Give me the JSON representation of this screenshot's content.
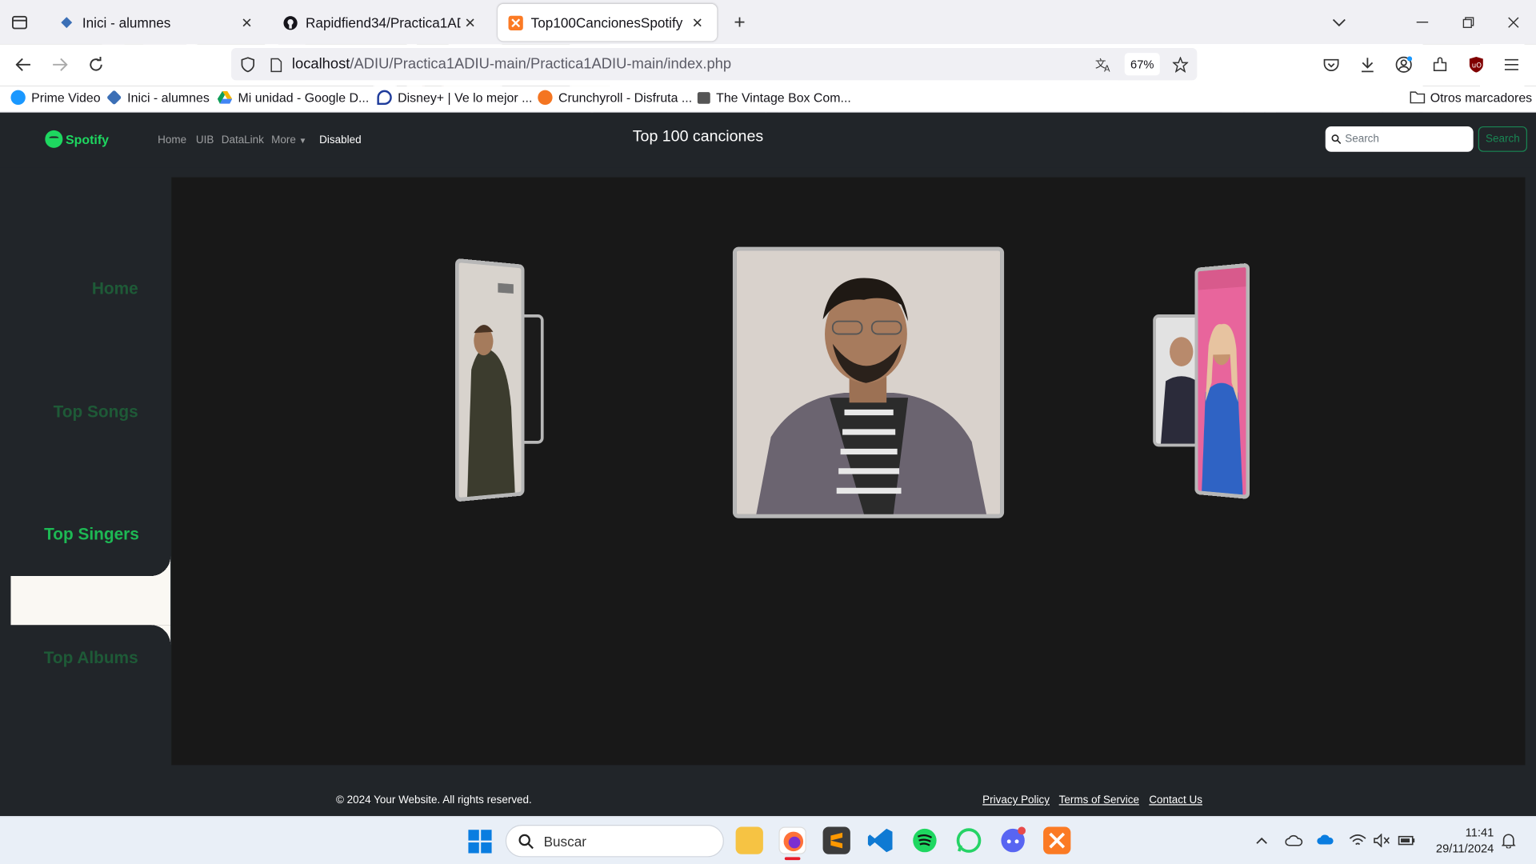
{
  "browser": {
    "tabs": [
      {
        "title": "Inici - alumnes",
        "icon": "uib-icon"
      },
      {
        "title": "Rapidfiend34/Practica1ADIU",
        "icon": "github-icon"
      },
      {
        "title": "Top100CancionesSpotify",
        "icon": "xampp-icon"
      }
    ],
    "url_host": "localhost",
    "url_path": "/ADIU/Practica1ADIU-main/Practica1ADIU-main/index.php",
    "zoom": "67%",
    "bookmarks": [
      {
        "label": "Prime Video",
        "color": "#1a98ff"
      },
      {
        "label": "Inici - alumnes",
        "color": "#3b6fb6"
      },
      {
        "label": "Mi unidad - Google D...",
        "color": "#f4b400"
      },
      {
        "label": "Disney+ | Ve lo mejor ...",
        "color": "#1f3c9b"
      },
      {
        "label": "Crunchyroll - Disfruta ...",
        "color": "#f47521"
      },
      {
        "label": "The Vintage Box Com...",
        "color": "#555555"
      }
    ],
    "other_bookmarks": "Otros marcadores"
  },
  "site": {
    "logo_text": "Spotify",
    "nav": {
      "home": "Home",
      "uib": "UIB",
      "datalink": "DataLink",
      "more": "More",
      "disabled": "Disabled"
    },
    "title": "Top 100 canciones",
    "search_placeholder": "Search",
    "search_button": "Search"
  },
  "sidebar": {
    "items": [
      "Home",
      "Top Songs",
      "Top Singers",
      "Top Albums"
    ],
    "active": "Top Singers"
  },
  "carousel": {
    "cards": [
      "left-singer",
      "center-singer",
      "right-singer"
    ]
  },
  "footer": {
    "copyright": "© 2024 Your Website. All rights reserved.",
    "links": [
      "Privacy Policy",
      "Terms of Service",
      "Contact Us"
    ]
  },
  "taskbar": {
    "search_placeholder": "Buscar",
    "time": "11:41",
    "date": "29/11/2024"
  },
  "colors": {
    "accent": "#1ed760",
    "sidebar_text": "#1e5a37",
    "active_sidebar_text": "#1db954",
    "page_bg": "#212529"
  }
}
